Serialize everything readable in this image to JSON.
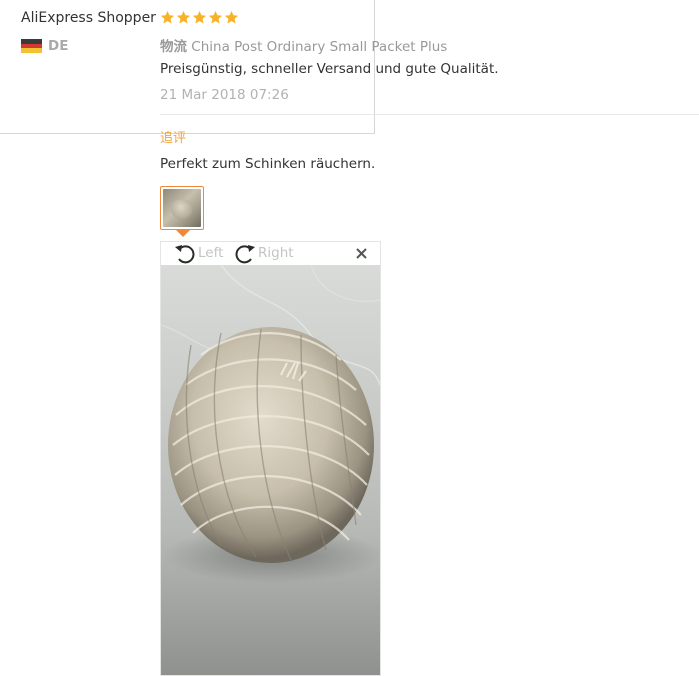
{
  "user": {
    "name": "AliExpress Shopper",
    "country_code": "DE",
    "flag_colors": [
      "#3a3a3a",
      "#d23a2f",
      "#f2c230"
    ]
  },
  "review": {
    "rating": 5,
    "star_color": "#f7b32b",
    "shipping_label": "物流",
    "shipping_method": "China Post Ordinary Small Packet Plus",
    "text": "Preisgünstig, schneller Versand und gute Qualität.",
    "date": "21 Mar 2018 07:26"
  },
  "followup": {
    "label": "追评",
    "text": "Perfekt zum Schinken räuchern."
  },
  "viewer": {
    "rotate_left_label": "Left",
    "rotate_right_label": "Right",
    "rotate_left_icon": "rotate-left-icon",
    "rotate_right_icon": "rotate-right-icon",
    "close_icon": "close-icon",
    "accent_color": "#f0883a"
  }
}
